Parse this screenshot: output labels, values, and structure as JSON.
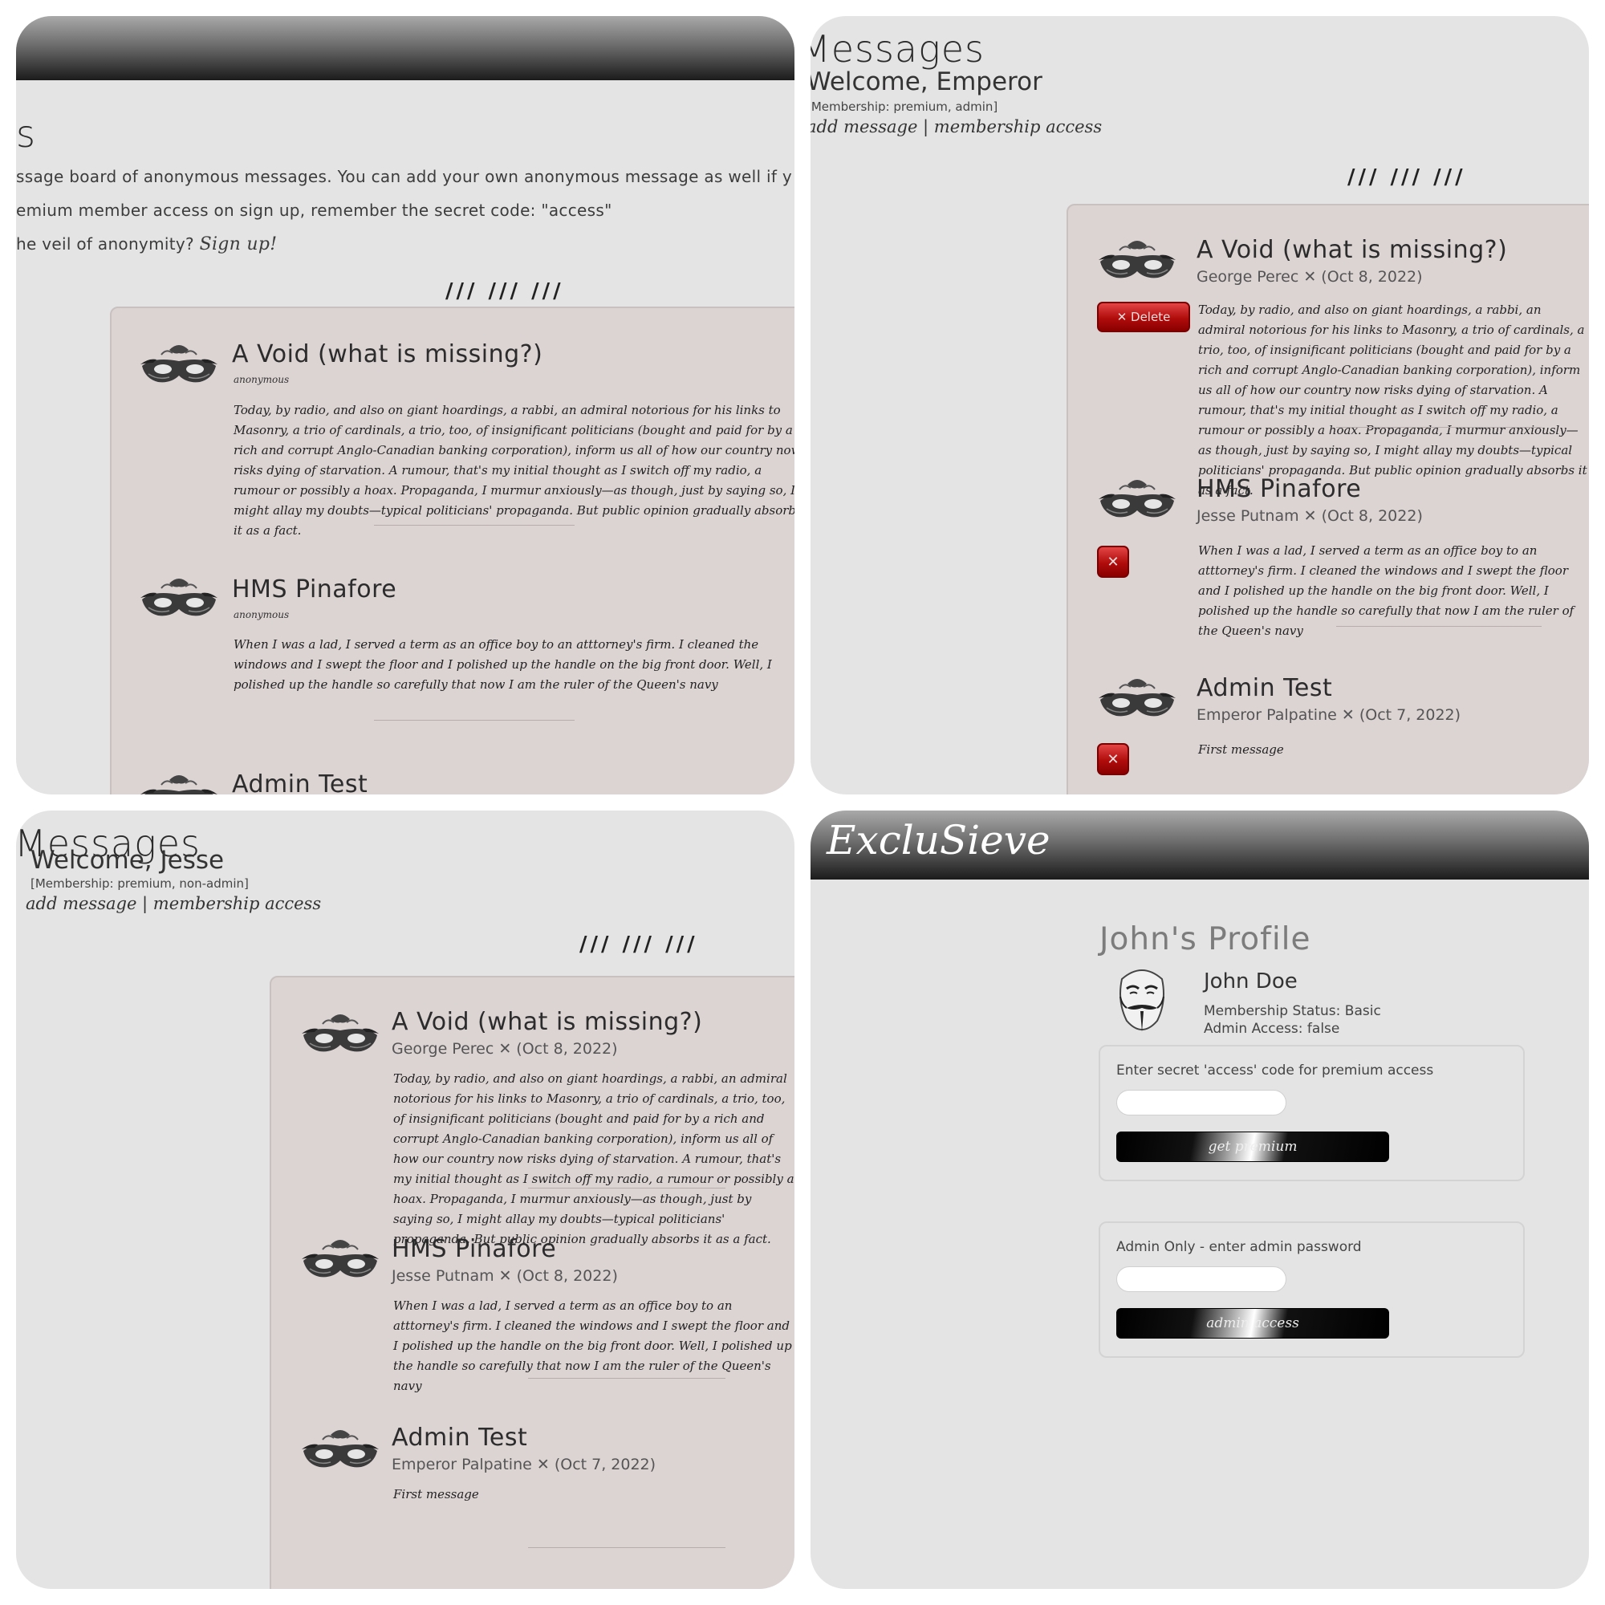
{
  "panel1": {
    "title_fragment": "s",
    "intro_lines": [
      "ssage board of anonymous messages. You can add your own anonymous message as well if y",
      "emium member access on sign up, remember the secret code: \"access\""
    ],
    "signup_prompt": "he veil of anonymity?",
    "signup_link": "Sign up!",
    "divider": "/// /// ///",
    "messages": [
      {
        "title": "A Void (what is missing?)",
        "author": "anonymous",
        "body": "Today, by radio, and also on giant hoardings, a rabbi, an admiral notorious for his links to Masonry, a trio of cardinals, a trio, too, of insignificant politicians (bought and paid for by a rich and corrupt Anglo-Canadian banking corporation), inform us all of how our country now risks dying of starvation. A rumour, that's my initial thought as I switch off my radio, a rumour or possibly a hoax. Propaganda, I murmur anxiously—as though, just by saying so, I might allay my doubts—typical politicians' propaganda. But public opinion gradually absorbs it as a fact."
      },
      {
        "title": "HMS Pinafore",
        "author": "anonymous",
        "body": "When I was a lad, I served a term as an office boy to an atttorney's firm. I cleaned the windows and I swept the floor and I polished up the handle on the big front door. Well, I polished up the handle so carefully that now I am the ruler of the Queen's navy"
      },
      {
        "title": "Admin Test"
      }
    ]
  },
  "panel2": {
    "title": "Messages",
    "welcome": "Welcome, Emperor",
    "membership": "[Membership: premium, admin]",
    "nav": "add message | membership access",
    "divider": "/// /// ///",
    "delete_label": "✕ Delete",
    "delete_small": "✕",
    "messages": [
      {
        "title": "A Void (what is missing?)",
        "author": "George Perec ✕ (Oct 8, 2022)",
        "body": "Today, by radio, and also on giant hoardings, a rabbi, an admiral notorious for his links to Masonry, a trio of cardinals, a trio, too, of insignificant politicians (bought and paid for by a rich and corrupt Anglo-Canadian banking corporation), inform us all of how our country now risks dying of starvation. A rumour, that's my initial thought as I switch off my radio, a rumour or possibly a hoax. Propaganda, I murmur anxiously—as though, just by saying so, I might allay my doubts—typical politicians' propaganda. But public opinion gradually absorbs it as a fact."
      },
      {
        "title": "HMS Pinafore",
        "author": "Jesse Putnam ✕ (Oct 8, 2022)",
        "body": "When I was a lad, I served a term as an office boy to an atttorney's firm. I cleaned the windows and I swept the floor and I polished up the handle on the big front door. Well, I polished up the handle so carefully that now I am the ruler of the Queen's navy"
      },
      {
        "title": "Admin Test",
        "author": "Emperor Palpatine ✕ (Oct 7, 2022)",
        "body": "First message"
      }
    ]
  },
  "panel3": {
    "title": "Messages",
    "welcome": "Welcome, Jesse",
    "membership": "[Membership: premium, non-admin]",
    "nav": "add message | membership access",
    "divider": "/// /// ///",
    "messages": [
      {
        "title": "A Void (what is missing?)",
        "author": "George Perec ✕ (Oct 8, 2022)",
        "body": "Today, by radio, and also on giant hoardings, a rabbi, an admiral notorious for his links to Masonry, a trio of cardinals, a trio, too, of insignificant politicians (bought and paid for by a rich and corrupt Anglo-Canadian banking corporation), inform us all of how our country now risks dying of starvation. A rumour, that's my initial thought as I switch off my radio, a rumour or possibly a hoax. Propaganda, I murmur anxiously—as though, just by saying so, I might allay my doubts—typical politicians' propaganda. But public opinion gradually absorbs it as a fact."
      },
      {
        "title": "HMS Pinafore",
        "author": "Jesse Putnam ✕ (Oct 8, 2022)",
        "body": "When I was a lad, I served a term as an office boy to an atttorney's firm. I cleaned the windows and I swept the floor and I polished up the handle on the big front door. Well, I polished up the handle so carefully that now I am the ruler of the Queen's navy"
      },
      {
        "title": "Admin Test",
        "author": "Emperor Palpatine ✕ (Oct 7, 2022)",
        "body": "First message"
      }
    ]
  },
  "panel4": {
    "logo": "ExcluSieve",
    "profile_title": "John's Profile",
    "name": "John Doe",
    "membership_status": "Membership Status: Basic",
    "admin_access": "Admin Access: false",
    "premium_form": {
      "label": "Enter secret 'access' code for premium access",
      "input_value": "",
      "button": "get premium"
    },
    "admin_form": {
      "label": "Admin Only - enter admin password",
      "input_value": "",
      "button": "admin access"
    }
  },
  "colors": {
    "page_bg": "#e5e4e5",
    "board_bg": "#dcd3d3",
    "delete_red": "#b00c0c",
    "header_dark": "#1b1b1b"
  }
}
